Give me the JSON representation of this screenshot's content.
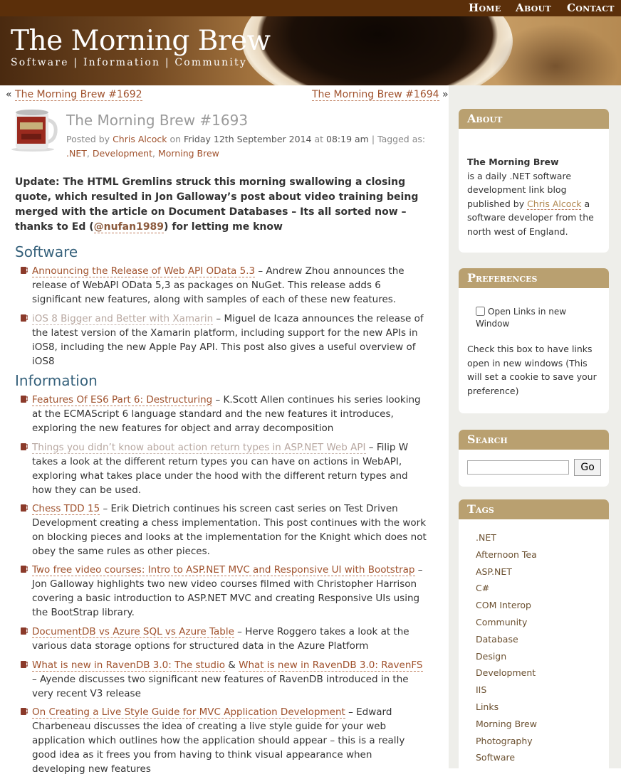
{
  "nav": {
    "home": "Home",
    "about": "About",
    "contact": "Contact"
  },
  "header": {
    "title": "The Morning Brew",
    "tagline": "Software | Information | Community"
  },
  "post_nav": {
    "prev_arrow": "«",
    "prev": "The Morning Brew #1692",
    "next": "The Morning Brew #1694",
    "next_arrow": "»"
  },
  "post": {
    "title": "The Morning Brew #1693",
    "meta": {
      "posted_by": "Posted by",
      "author": "Chris Alcock",
      "on": "on",
      "date": "Friday 12th September 2014",
      "at": "at",
      "time": "08:19 am",
      "tagged": "| Tagged as:",
      "tag1": ".NET",
      "tag2": "Development",
      "tag3": "Morning Brew",
      "comma": ","
    },
    "update": {
      "text": "Update: The HTML Gremlins struck this morning swallowing a closing quote, which resulted in Jon Galloway’s post about video training being merged with the article on Document Databases – Its all sorted now – thanks to Ed (",
      "handle": "@nufan1989",
      "end": ") for letting me know"
    }
  },
  "sections": {
    "software": "Software",
    "information": "Information"
  },
  "items": {
    "s1": {
      "link": "Announcing the Release of Web API OData 5.3",
      "text": " – Andrew Zhou announces the release of WebAPI OData 5,3 as packages on NuGet. This release adds 6 significant new features, along with samples of each of these new features."
    },
    "s2": {
      "link": "iOS 8 Bigger and Better with Xamarin",
      "text": " – Miguel de Icaza announces the release of the latest version of the Xamarin platform, including support for the new APIs in iOS8, including the new Apple Pay API. This post also gives a useful overview of iOS8"
    },
    "i1": {
      "link": "Features Of ES6 Part 6: Destructuring",
      "text": " – K.Scott Allen continues his series looking at the ECMAScript 6 language standard and the new features it introduces, exploring the new features for object and array decomposition"
    },
    "i2": {
      "link": "Things you didn’t know about action return types in ASP.NET Web API",
      "text": " – Filip W takes a look at the different return types you can have on actions in WebAPI, exploring what takes place under the hood with the different return types and how they can be used."
    },
    "i3": {
      "link": "Chess TDD 15",
      "text": " – Erik Dietrich continues his screen cast series on Test Driven Development creating a chess implementation. This post continues with the work on blocking pieces and looks at the implementation for the Knight which does not obey the same rules as other pieces."
    },
    "i4": {
      "link": "Two free video courses: Intro to ASP.NET MVC and Responsive UI with Bootstrap",
      "text": " – Jon Galloway highlights two new video courses filmed with Christopher Harrison covering a basic introduction to ASP.NET MVC and creating Responsive UIs using the BootStrap library."
    },
    "i5": {
      "link": "DocumentDB vs Azure SQL vs Azure Table",
      "text": " – Herve Roggero takes a look at the various data storage options for structured data in the Azure Platform"
    },
    "i6": {
      "link": "What is new in RavenDB 3.0: The studio",
      "amp": " & ",
      "link2": "What is new in RavenDB 3.0: RavenFS",
      "text": " – Ayende discusses two significant new features of RavenDB introduced in the very recent V3 release"
    },
    "i7": {
      "link": "On Creating a Live Style Guide for MVC Application Development",
      "text": " – Edward Charbeneau discusses the idea of creating a live style guide for your web application which outlines how the application should appear – this is a really good idea as it frees you from having to think visual appearance when developing new features"
    }
  },
  "sidebar": {
    "about": {
      "title": "About",
      "name": "The Morning Brew",
      "text1": "is a daily .NET software development link blog published by ",
      "author": "Chris Alcock",
      "text2": " a software developer from the north west of England."
    },
    "preferences": {
      "title": "Preferences",
      "checkbox_label": "Open Links in new Window",
      "text": "Check this box to have links open in new windows (This will set a cookie to save your preference)"
    },
    "search": {
      "title": "Search",
      "value": "",
      "button": "Go"
    },
    "tags": {
      "title": "Tags",
      "items": [
        ".NET",
        "Afternoon Tea",
        "ASP.NET",
        "C#",
        "COM Interop",
        "Community",
        "Database",
        "Design",
        "Development",
        "IIS",
        "Links",
        "Morning Brew",
        "Photography",
        "Software"
      ]
    }
  },
  "colors": {
    "nav": "#5b2f0a",
    "link": "#a0522d",
    "heading": "#36617b",
    "widget_title": "#b9a070",
    "sidebar_bg": "#eeeeea"
  }
}
